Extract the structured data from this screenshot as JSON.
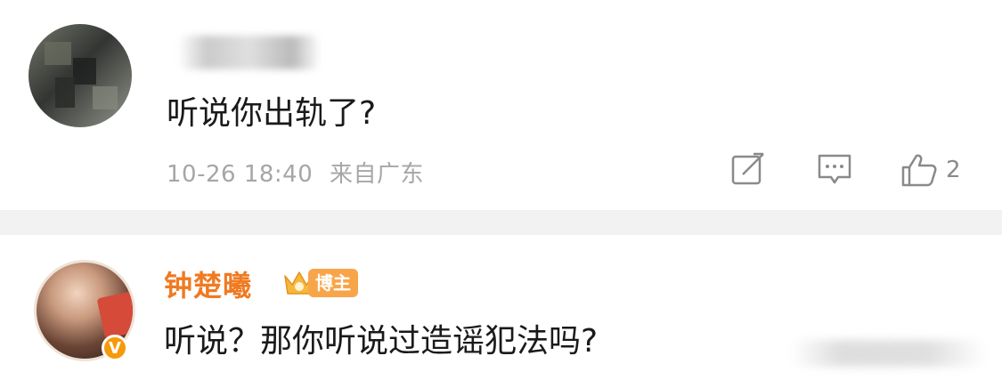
{
  "comments": [
    {
      "username": "",
      "text": "听说你出轨了?",
      "timestamp": "10-26 18:40",
      "location": "来自广东",
      "actions": {
        "share_icon": "edit-share-icon",
        "comment_icon": "comment-icon",
        "like_icon": "thumbs-up-icon",
        "like_count": "2"
      }
    },
    {
      "username": "钟楚曦",
      "badge": "博主",
      "text": "听说？那你听说过造谣犯法吗?",
      "verified_mark": "V"
    }
  ],
  "colors": {
    "name_orange": "#ef7a22",
    "badge_orange": "#f8a54a",
    "meta_gray": "#a6a6a6",
    "divider": "#f2f2f2"
  }
}
